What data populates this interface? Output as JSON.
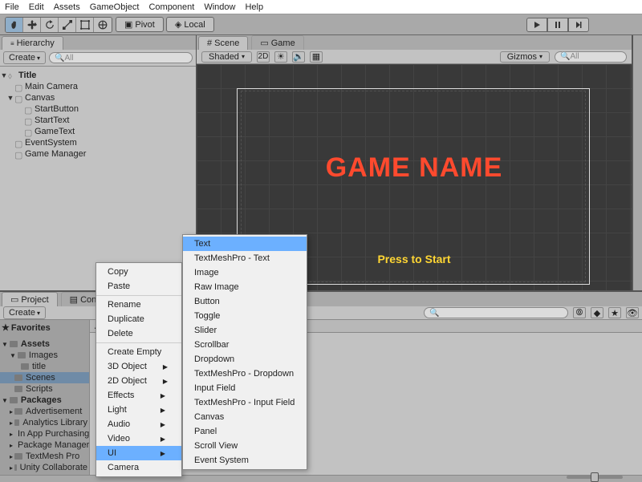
{
  "menubar": [
    "File",
    "Edit",
    "Assets",
    "GameObject",
    "Component",
    "Window",
    "Help"
  ],
  "toolbar": {
    "pivot_label": "Pivot",
    "local_label": "Local"
  },
  "hierarchy": {
    "tab": "Hierarchy",
    "create": "Create",
    "search_placeholder": "All",
    "scene": "Title",
    "nodes": [
      {
        "label": "Main Camera",
        "depth": 1
      },
      {
        "label": "Canvas",
        "depth": 1,
        "expanded": true
      },
      {
        "label": "StartButton",
        "depth": 2
      },
      {
        "label": "StartText",
        "depth": 2
      },
      {
        "label": "GameText",
        "depth": 2
      },
      {
        "label": "EventSystem",
        "depth": 1
      },
      {
        "label": "Game Manager",
        "depth": 1
      }
    ]
  },
  "center": {
    "scene_tab": "Scene",
    "game_tab": "Game",
    "shading": "Shaded",
    "mode_2d": "2D",
    "gizmos": "Gizmos",
    "search_placeholder": "All",
    "game_name": "GAME NAME",
    "press_start": "Press to Start"
  },
  "project": {
    "project_tab": "Project",
    "console_tab": "Console",
    "create": "Create",
    "favorites": "Favorites",
    "assets_header": "Assets",
    "assets": {
      "root": "Assets",
      "items": [
        {
          "label": "Images",
          "depth": 1,
          "expanded": true
        },
        {
          "label": "title",
          "depth": 2
        },
        {
          "label": "Scenes",
          "depth": 1,
          "selected": true
        },
        {
          "label": "Scripts",
          "depth": 1
        }
      ]
    },
    "packages": {
      "root": "Packages",
      "items": [
        "Advertisement",
        "Analytics Library",
        "In App Purchasing",
        "Package Manager UI",
        "TextMesh Pro",
        "Unity Collaborate"
      ]
    }
  },
  "context_primary": {
    "items": [
      {
        "label": "Copy"
      },
      {
        "label": "Paste"
      },
      {
        "label": "Rename",
        "disabled": true,
        "sep": true
      },
      {
        "label": "Duplicate"
      },
      {
        "label": "Delete"
      },
      {
        "label": "Create Empty",
        "sep": true
      },
      {
        "label": "3D Object",
        "sub": true
      },
      {
        "label": "2D Object",
        "sub": true
      },
      {
        "label": "Effects",
        "sub": true
      },
      {
        "label": "Light",
        "sub": true
      },
      {
        "label": "Audio",
        "sub": true
      },
      {
        "label": "Video",
        "sub": true
      },
      {
        "label": "UI",
        "sub": true,
        "selected": true
      },
      {
        "label": "Camera"
      }
    ]
  },
  "context_ui": {
    "items": [
      {
        "label": "Text",
        "selected": true
      },
      {
        "label": "TextMeshPro - Text"
      },
      {
        "label": "Image"
      },
      {
        "label": "Raw Image"
      },
      {
        "label": "Button"
      },
      {
        "label": "Toggle"
      },
      {
        "label": "Slider"
      },
      {
        "label": "Scrollbar"
      },
      {
        "label": "Dropdown"
      },
      {
        "label": "TextMeshPro - Dropdown"
      },
      {
        "label": "Input Field"
      },
      {
        "label": "TextMeshPro - Input Field"
      },
      {
        "label": "Canvas"
      },
      {
        "label": "Panel"
      },
      {
        "label": "Scroll View"
      },
      {
        "label": "Event System"
      }
    ]
  }
}
